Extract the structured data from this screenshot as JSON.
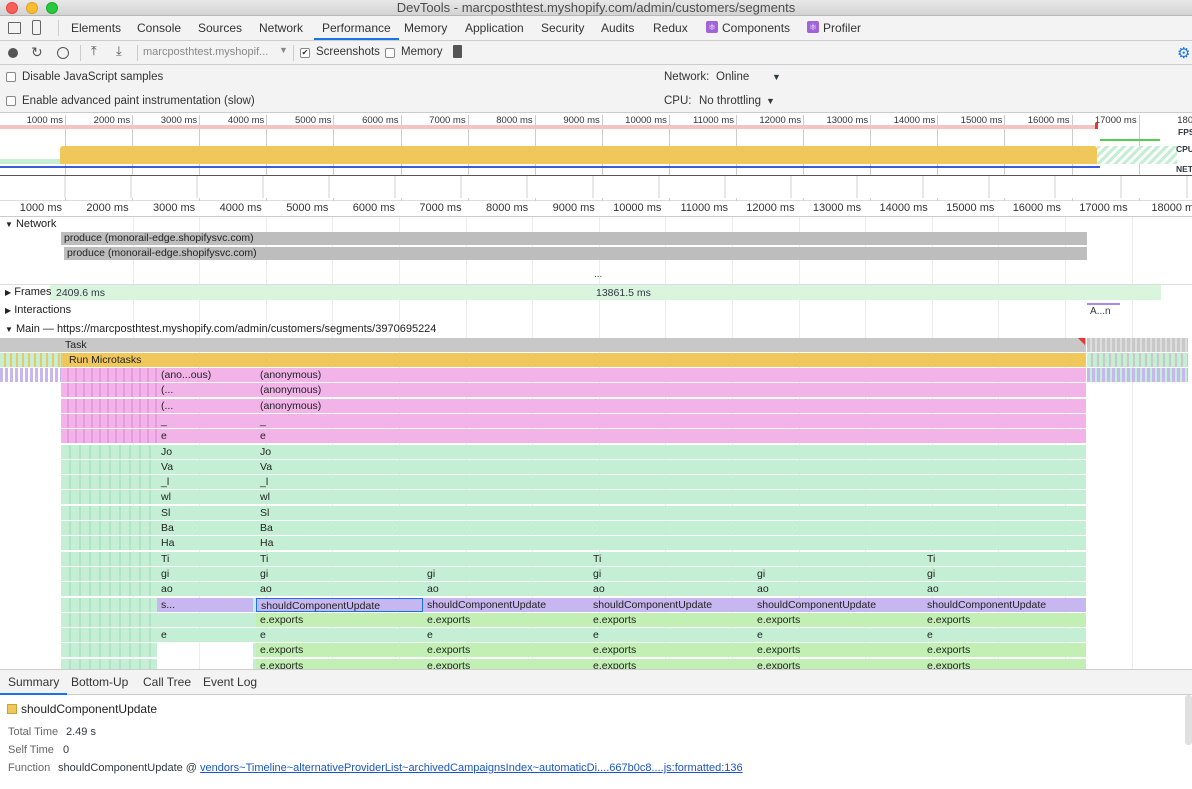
{
  "window": {
    "title": "DevTools - marcposthtest.myshopify.com/admin/customers/segments"
  },
  "tabs": [
    "Elements",
    "Console",
    "Sources",
    "Network",
    "Performance",
    "Memory",
    "Application",
    "Security",
    "Audits",
    "Redux",
    "Components",
    "Profiler"
  ],
  "active_tab": "Performance",
  "toolbar": {
    "profile_select": "marcposthtest.myshopif...",
    "screenshots_label": "Screenshots",
    "memory_label": "Memory"
  },
  "settings": {
    "disable_js_samples": "Disable JavaScript samples",
    "adv_paint": "Enable advanced paint instrumentation (slow)",
    "network_label": "Network:",
    "network_value": "Online",
    "cpu_label": "CPU:",
    "cpu_value": "No throttling"
  },
  "overview": {
    "ticks": [
      "1000 ms",
      "2000 ms",
      "3000 ms",
      "4000 ms",
      "5000 ms",
      "6000 ms",
      "7000 ms",
      "8000 ms",
      "9000 ms",
      "10000 ms",
      "11000 ms",
      "12000 ms",
      "13000 ms",
      "14000 ms",
      "15000 ms",
      "16000 ms",
      "17000 ms",
      "18000"
    ],
    "fps_label": "FPS",
    "cpu_label": "CPU",
    "net_label": "NET"
  },
  "ruler": {
    "ticks": [
      "1000 ms",
      "2000 ms",
      "3000 ms",
      "4000 ms",
      "5000 ms",
      "6000 ms",
      "7000 ms",
      "8000 ms",
      "9000 ms",
      "10000 ms",
      "11000 ms",
      "12000 ms",
      "13000 ms",
      "14000 ms",
      "15000 ms",
      "16000 ms",
      "17000 ms",
      "18000 m"
    ]
  },
  "network_track": {
    "label": "Network",
    "requests": [
      "produce (monorail-edge.shopifysvc.com)",
      "produce (monorail-edge.shopifysvc.com)"
    ]
  },
  "frames_track": {
    "label": "Frames",
    "value1": "2409.6 ms",
    "value2": "13861.5 ms"
  },
  "interactions_track": {
    "label": "Interactions",
    "marker": "A...n"
  },
  "main_track": {
    "label": "Main — https://marcposthtest.myshopify.com/admin/customers/segments/3970695224",
    "task": "Task",
    "microtasks": "Run Microtasks",
    "left_col": [
      "(ano...ous)",
      "(...",
      "(...",
      "_",
      "e",
      "Jo",
      "Va",
      "_l",
      "wl",
      "Sl",
      "Ba",
      "Ha",
      "Ti",
      "gi",
      "ao",
      "s...",
      "",
      "e"
    ],
    "main_col": [
      "(anonymous)",
      "(anonymous)",
      "(anonymous)",
      "_",
      "e",
      "Jo",
      "Va",
      "_l",
      "wl",
      "Sl",
      "Ba",
      "Ha",
      "Ti",
      "gi",
      "ao",
      "shouldComponentUpdate",
      "e.exports",
      "e",
      "e.exports",
      "e.exports"
    ],
    "sub_col": [
      "gi",
      "ao",
      "shouldComponentUpdate",
      "e.exports",
      "e",
      "e.exports",
      "e.exports"
    ],
    "ti": "Ti"
  },
  "bottom_tabs": [
    "Summary",
    "Bottom-Up",
    "Call Tree",
    "Event Log"
  ],
  "summary": {
    "title": "shouldComponentUpdate",
    "total_time_label": "Total Time",
    "total_time": "2.49 s",
    "self_time_label": "Self Time",
    "self_time": "0",
    "function_label": "Function",
    "function_name": "shouldComponentUpdate @",
    "function_link": "vendors~Timeline~alternativeProviderList~archivedCampaignsIndex~automaticDi....667b0c8....js:formatted:136"
  },
  "colors": {
    "task_gray": "#c8c8c8",
    "microtask_yellow": "#f0c75a",
    "anon_pink": "#f1b3e8",
    "frame_green": "#c4efd4",
    "scu_purple": "#c6b7f0",
    "exports_green": "#c2f0b4",
    "accent_blue": "#1a73e8"
  }
}
